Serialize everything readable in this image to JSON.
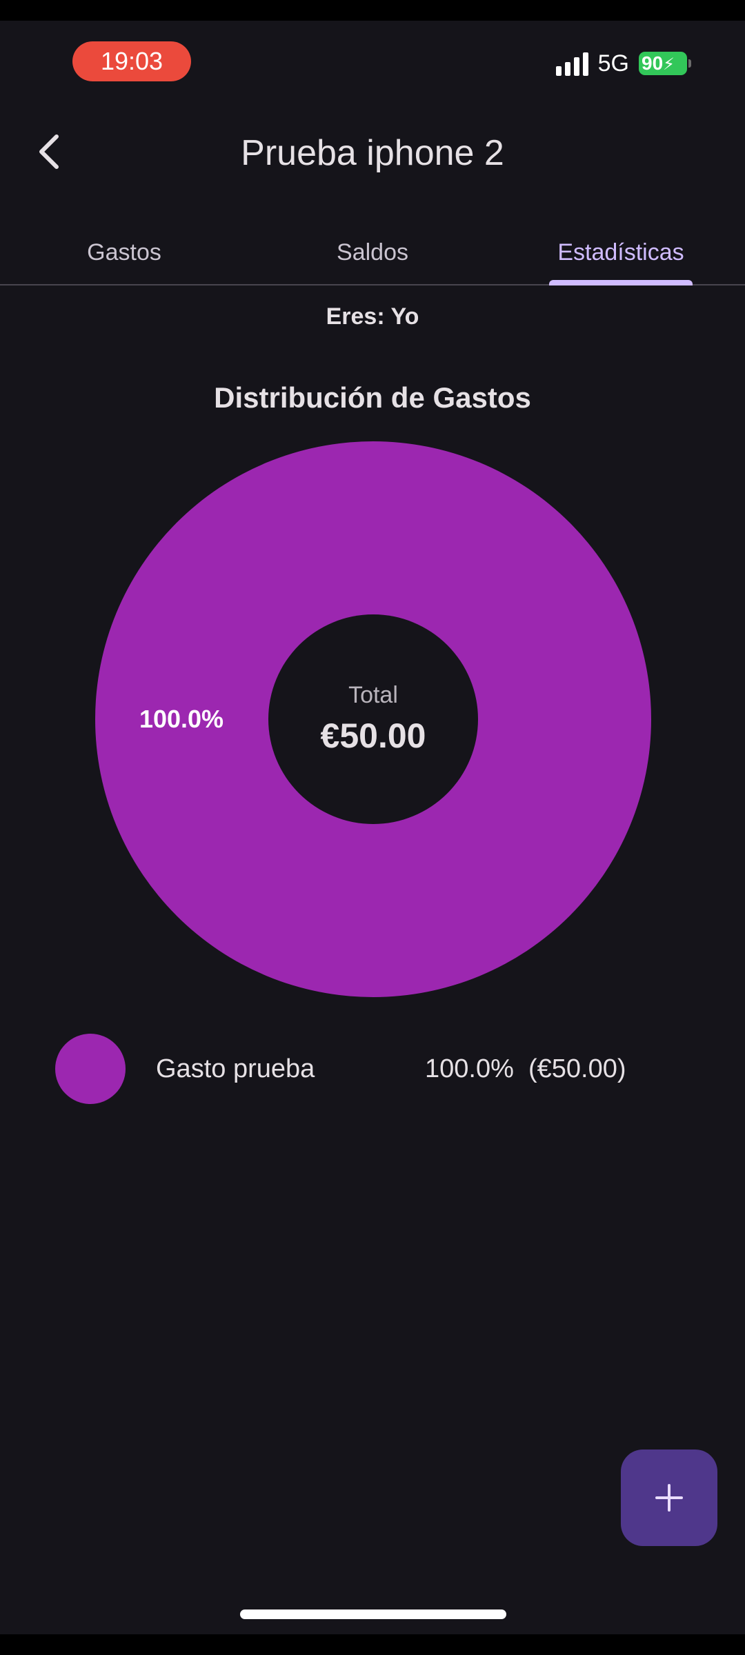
{
  "status_bar": {
    "time": "19:03",
    "network": "5G",
    "battery": "90"
  },
  "app_bar": {
    "back_icon": "chevron-left-icon",
    "title": "Prueba iphone 2"
  },
  "tabs": [
    {
      "label": "Gastos",
      "active": false
    },
    {
      "label": "Saldos",
      "active": false
    },
    {
      "label": "Estadísticas",
      "active": true
    }
  ],
  "user_label": "Eres: Yo",
  "chart_title": "Distribución de Gastos",
  "chart_data": {
    "type": "pie",
    "title": "Distribución de Gastos",
    "center_label": "Total",
    "center_value": "€50.00",
    "categories": [
      "Gasto prueba"
    ],
    "values": [
      50.0
    ],
    "percent_labels": [
      "100.0%"
    ],
    "colors": [
      "#9c27b0"
    ]
  },
  "legend": [
    {
      "name": "Gasto prueba",
      "value": "100.0%  (€50.00)",
      "color": "#9c27b0"
    }
  ],
  "fab": {
    "icon": "plus-icon"
  },
  "colors": {
    "background": "#15141a",
    "accent": "#d0bcff",
    "slice": "#9c27b0",
    "fab": "#4f378b",
    "status_time": "#eb4a3c",
    "battery": "#32c759"
  }
}
